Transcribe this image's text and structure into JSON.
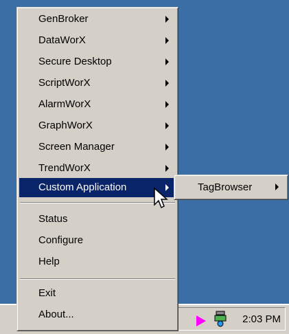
{
  "main_menu": {
    "items": [
      {
        "label": "GenBroker",
        "submenu": true
      },
      {
        "label": "DataWorX",
        "submenu": true
      },
      {
        "label": "Secure Desktop",
        "submenu": true
      },
      {
        "label": "ScriptWorX",
        "submenu": true
      },
      {
        "label": "AlarmWorX",
        "submenu": true
      },
      {
        "label": "GraphWorX",
        "submenu": true
      },
      {
        "label": "Screen Manager",
        "submenu": true
      },
      {
        "label": "TrendWorX",
        "submenu": true
      },
      {
        "label": "Custom Application",
        "submenu": true,
        "selected": true
      },
      {
        "label": "Status"
      },
      {
        "label": "Configure"
      },
      {
        "label": "Help"
      },
      {
        "label": "Exit"
      },
      {
        "label": "About..."
      }
    ]
  },
  "sub_menu": {
    "items": [
      {
        "label": "TagBrowser",
        "submenu": true
      }
    ]
  },
  "taskbar": {
    "clock": "2:03 PM"
  },
  "colors": {
    "desktop": "#3a6ea5",
    "menu_bg": "#d4d0c8",
    "highlight": "#0a246a",
    "tray_arrow": "#ff00ff"
  }
}
